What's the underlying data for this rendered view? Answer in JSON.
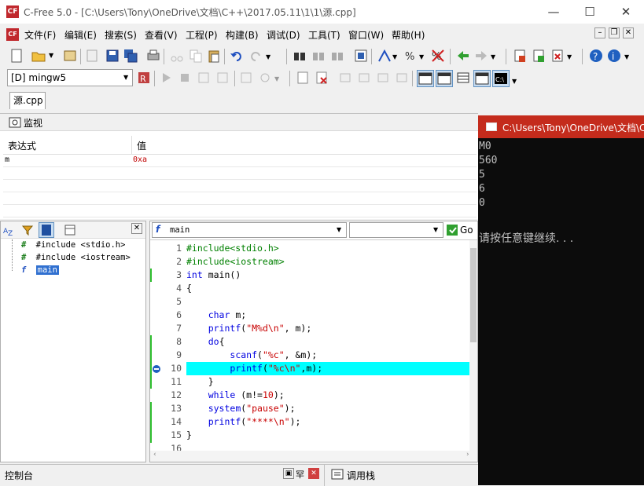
{
  "window": {
    "title": "C-Free 5.0 - [C:\\Users\\Tony\\OneDrive\\文档\\C++\\2017.05.11\\1\\1\\源.cpp]",
    "app_icon_text": "CF",
    "minimize": "—",
    "maximize": "☐",
    "close": "✕"
  },
  "menu": {
    "items": [
      "文件(F)",
      "编辑(E)",
      "搜索(S)",
      "查看(V)",
      "工程(P)",
      "构建(B)",
      "调试(D)",
      "工具(T)",
      "窗口(W)",
      "帮助(H)"
    ],
    "mdi_minimize": "–",
    "mdi_restore": "❐",
    "mdi_close": "✕"
  },
  "toolbar": {
    "compiler_select": "[D] mingw5"
  },
  "tabs": {
    "file_tab": "源.cpp"
  },
  "watch": {
    "title": "监视",
    "col_expr": "表达式",
    "col_value": "值",
    "rows": [
      {
        "expr": "m",
        "value": "0xa"
      }
    ]
  },
  "outline": {
    "items": [
      {
        "icon": "#",
        "label": "#include <stdio.h>"
      },
      {
        "icon": "#",
        "label": "#include <iostream>"
      },
      {
        "icon": "f",
        "label": "main"
      }
    ]
  },
  "editor": {
    "function_select": "main",
    "go_label": "Go",
    "lines": [
      {
        "n": "1",
        "text": "#include<stdio.h>"
      },
      {
        "n": "2",
        "text": "#include<iostream>"
      },
      {
        "n": "3",
        "text": "int main()"
      },
      {
        "n": "4",
        "text": "{"
      },
      {
        "n": "5",
        "text": ""
      },
      {
        "n": "6",
        "text": "    char m;"
      },
      {
        "n": "7",
        "text": "    printf(\"M%d\\n\", m);"
      },
      {
        "n": "8",
        "text": "    do{"
      },
      {
        "n": "9",
        "text": "        scanf(\"%c\", &m);"
      },
      {
        "n": "10",
        "text": "        printf(\"%c\\n\",m);"
      },
      {
        "n": "11",
        "text": "    }"
      },
      {
        "n": "12",
        "text": "    while (m!=10);"
      },
      {
        "n": "13",
        "text": "    system(\"pause\");"
      },
      {
        "n": "14",
        "text": "    printf(\"****\\n\");"
      },
      {
        "n": "15",
        "text": "}"
      },
      {
        "n": "16",
        "text": ""
      }
    ],
    "current_line": "10"
  },
  "console": {
    "title": "C:\\Users\\Tony\\OneDrive\\文档\\C",
    "lines": [
      "M0",
      "560",
      "5",
      "6",
      "0",
      "",
      "请按任意键继续. . ."
    ]
  },
  "bottom": {
    "console_label": "控制台",
    "callstack_label": "调用栈",
    "pin": "▣",
    "float": "罕",
    "close": "✕"
  },
  "colors": {
    "highlight_line": "#00ffff",
    "keyword": "#0000e0",
    "string": "#c80000",
    "preprocessor": "#008000",
    "console_title": "#c42b1c"
  }
}
